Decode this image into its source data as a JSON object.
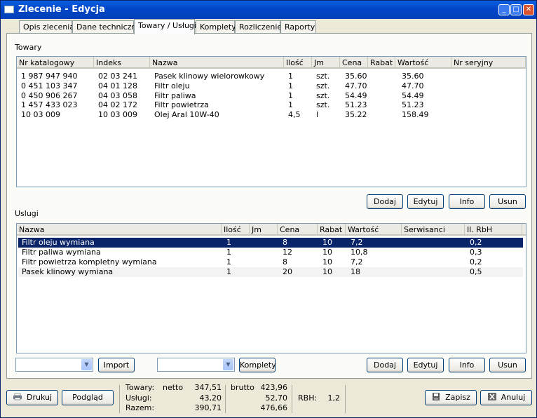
{
  "window": {
    "title": "Zlecenie - Edycja"
  },
  "tabs": [
    "Opis zlecenia",
    "Dane techniczne",
    "Towary / Usługi",
    "Komplety",
    "Rozliczenie",
    "Raporty"
  ],
  "towary": {
    "label": "Towary",
    "columns": [
      "Nr katalogowy",
      "Indeks",
      "Nazwa",
      "Ilość",
      "Jm",
      "Cena",
      "Rabat",
      "Wartość",
      "Nr seryjny"
    ],
    "rows": [
      [
        "1 987 947 940",
        "02 03 241",
        "Pasek klinowy wielorowkowy",
        "1",
        "szt.",
        "35.60",
        "",
        "35.60",
        ""
      ],
      [
        "0 451 103 347",
        "04 01 128",
        "Filtr oleju",
        "1",
        "szt.",
        "47.70",
        "",
        "47.70",
        ""
      ],
      [
        "0 450 906 267",
        "04 03 058",
        "Filtr paliwa",
        "1",
        "szt.",
        "54.49",
        "",
        "54.49",
        ""
      ],
      [
        "1 457 433 023",
        "04 02 172",
        "Filtr powietrza",
        "1",
        "szt.",
        "51.23",
        "",
        "51.23",
        ""
      ],
      [
        "10 03 009",
        "10 03 009",
        "Olej Aral 10W-40",
        "4,5",
        "l",
        "35.22",
        "",
        "158.49",
        ""
      ]
    ],
    "buttons": [
      "Dodaj",
      "Edytuj",
      "Info",
      "Usun"
    ]
  },
  "uslugi": {
    "label": "Uslugi",
    "columns": [
      "Nazwa",
      "Ilość",
      "Jm",
      "Cena",
      "Rabat",
      "Wartość",
      "Serwisanci",
      "Il. RbH"
    ],
    "rows": [
      [
        "Filtr oleju wymiana",
        "1",
        "",
        "8",
        "10",
        "7,2",
        "",
        "0,2"
      ],
      [
        "Filtr paliwa wymiana",
        "1",
        "",
        "12",
        "10",
        "10,8",
        "",
        "0,3"
      ],
      [
        "Filtr powietrza kompletny wymiana",
        "1",
        "",
        "8",
        "10",
        "7,2",
        "",
        "0,2"
      ],
      [
        "Pasek klinowy wymiana",
        "1",
        "",
        "20",
        "10",
        "18",
        "",
        "0,5"
      ]
    ],
    "buttons": [
      "Dodaj",
      "Edytuj",
      "Info",
      "Usun"
    ],
    "import_label": "Import",
    "komplety_label": "Komplety"
  },
  "footer": {
    "print_label": "Drukuj",
    "preview_label": "Podgląd",
    "towary_label": "Towary:",
    "netto_label": "netto",
    "towary_netto": "347,51",
    "brutto_label": "brutto",
    "towary_brutto": "423,96",
    "uslugi_label": "Usługi:",
    "uslugi_netto": "43,20",
    "uslugi_brutto": "52,70",
    "razem_label": "Razem:",
    "razem_netto": "390,71",
    "razem_brutto": "476,66",
    "rbh_label": "RBH:",
    "rbh_value": "1,2",
    "save_label": "Zapisz",
    "cancel_label": "Anuluj"
  }
}
